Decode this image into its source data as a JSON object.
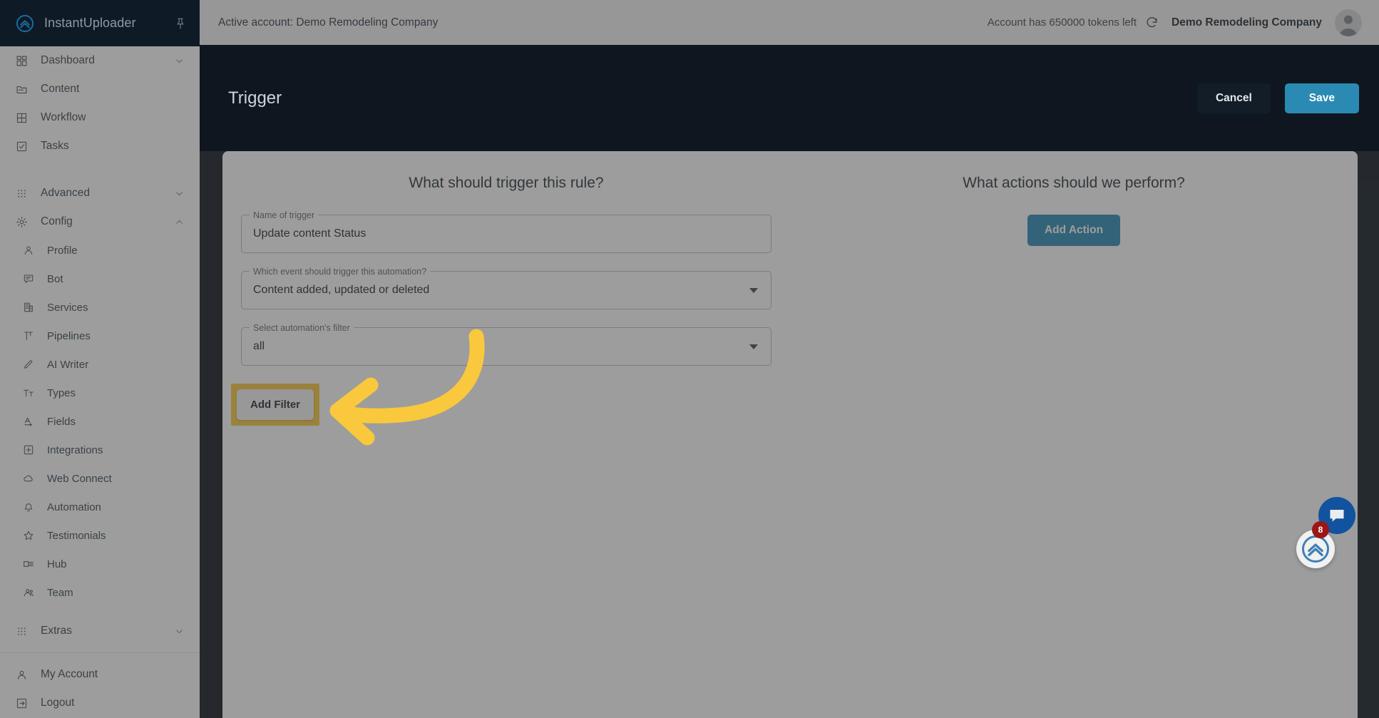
{
  "app": {
    "name": "InstantUploader",
    "logo_icon": "double-chevron-up-circle-icon",
    "pin_icon": "pushpin-icon"
  },
  "topbar": {
    "active_account_label": "Active account: Demo Remodeling Company",
    "tokens_label": "Account has 650000 tokens left",
    "refresh_icon": "refresh-icon",
    "account_name": "Demo Remodeling Company",
    "avatar_icon": "avatar-person-icon"
  },
  "page": {
    "title": "Trigger",
    "cancel_label": "Cancel",
    "save_label": "Save"
  },
  "sidebar": {
    "main": [
      {
        "label": "Dashboard",
        "icon": "dashboard-grid-icon",
        "chevron": "chevron-down-icon"
      },
      {
        "label": "Content",
        "icon": "folder-icon",
        "chevron": ""
      },
      {
        "label": "Workflow",
        "icon": "table-grid-icon",
        "chevron": ""
      },
      {
        "label": "Tasks",
        "icon": "checkbox-icon",
        "chevron": ""
      }
    ],
    "groups": [
      {
        "label": "Advanced",
        "icon": "apps-grid-icon",
        "chevron": "chevron-down-icon"
      },
      {
        "label": "Config",
        "icon": "gear-icon",
        "chevron": "chevron-up-icon"
      }
    ],
    "config_items": [
      {
        "label": "Profile",
        "icon": "person-icon"
      },
      {
        "label": "Bot",
        "icon": "chat-lines-icon"
      },
      {
        "label": "Services",
        "icon": "building-icon"
      },
      {
        "label": "Pipelines",
        "icon": "pipeline-icon"
      },
      {
        "label": "AI Writer",
        "icon": "pencil-icon"
      },
      {
        "label": "Types",
        "icon": "text-size-icon"
      },
      {
        "label": "Fields",
        "icon": "field-letter-icon"
      },
      {
        "label": "Integrations",
        "icon": "plus-square-icon"
      },
      {
        "label": "Web Connect",
        "icon": "cloud-icon"
      },
      {
        "label": "Automation",
        "icon": "bell-icon"
      },
      {
        "label": "Testimonials",
        "icon": "star-icon"
      },
      {
        "label": "Hub",
        "icon": "card-list-icon"
      },
      {
        "label": "Team",
        "icon": "people-icon"
      }
    ],
    "extras": {
      "label": "Extras",
      "icon": "apps-grid-icon",
      "chevron": "chevron-down-icon"
    },
    "footer": [
      {
        "label": "My Account",
        "icon": "person-icon"
      },
      {
        "label": "Logout",
        "icon": "logout-arrow-icon"
      }
    ]
  },
  "trigger_panel": {
    "heading": "What should trigger this rule?",
    "name_field": {
      "legend": "Name of trigger",
      "value": "Update content Status",
      "placeholder": "Name of trigger"
    },
    "event_field": {
      "legend": "Which event should trigger this automation?",
      "value": "Content added, updated or deleted",
      "caret": "chevron-down-icon"
    },
    "filter_field": {
      "legend": "Select automation's filter",
      "value": "all",
      "caret": "chevron-down-icon"
    },
    "add_filter_label": "Add Filter"
  },
  "actions_panel": {
    "heading": "What actions should we perform?",
    "add_action_label": "Add Action"
  },
  "widgets": {
    "chat_icon": "chat-bubble-icon",
    "chat_badge": "8",
    "scroll_top_icon": "double-chevron-up-circle-icon"
  },
  "annotation": {
    "highlight_color": "#FAC83C",
    "arrow_icon": "curved-arrow-left-icon"
  },
  "colors": {
    "accent": "#2b8ab4",
    "dark_bg": "#0e1720",
    "sidebar_header": "#0e1b26",
    "highlight": "#FAC83C",
    "badge": "#9c1616",
    "chat": "#11539e"
  }
}
